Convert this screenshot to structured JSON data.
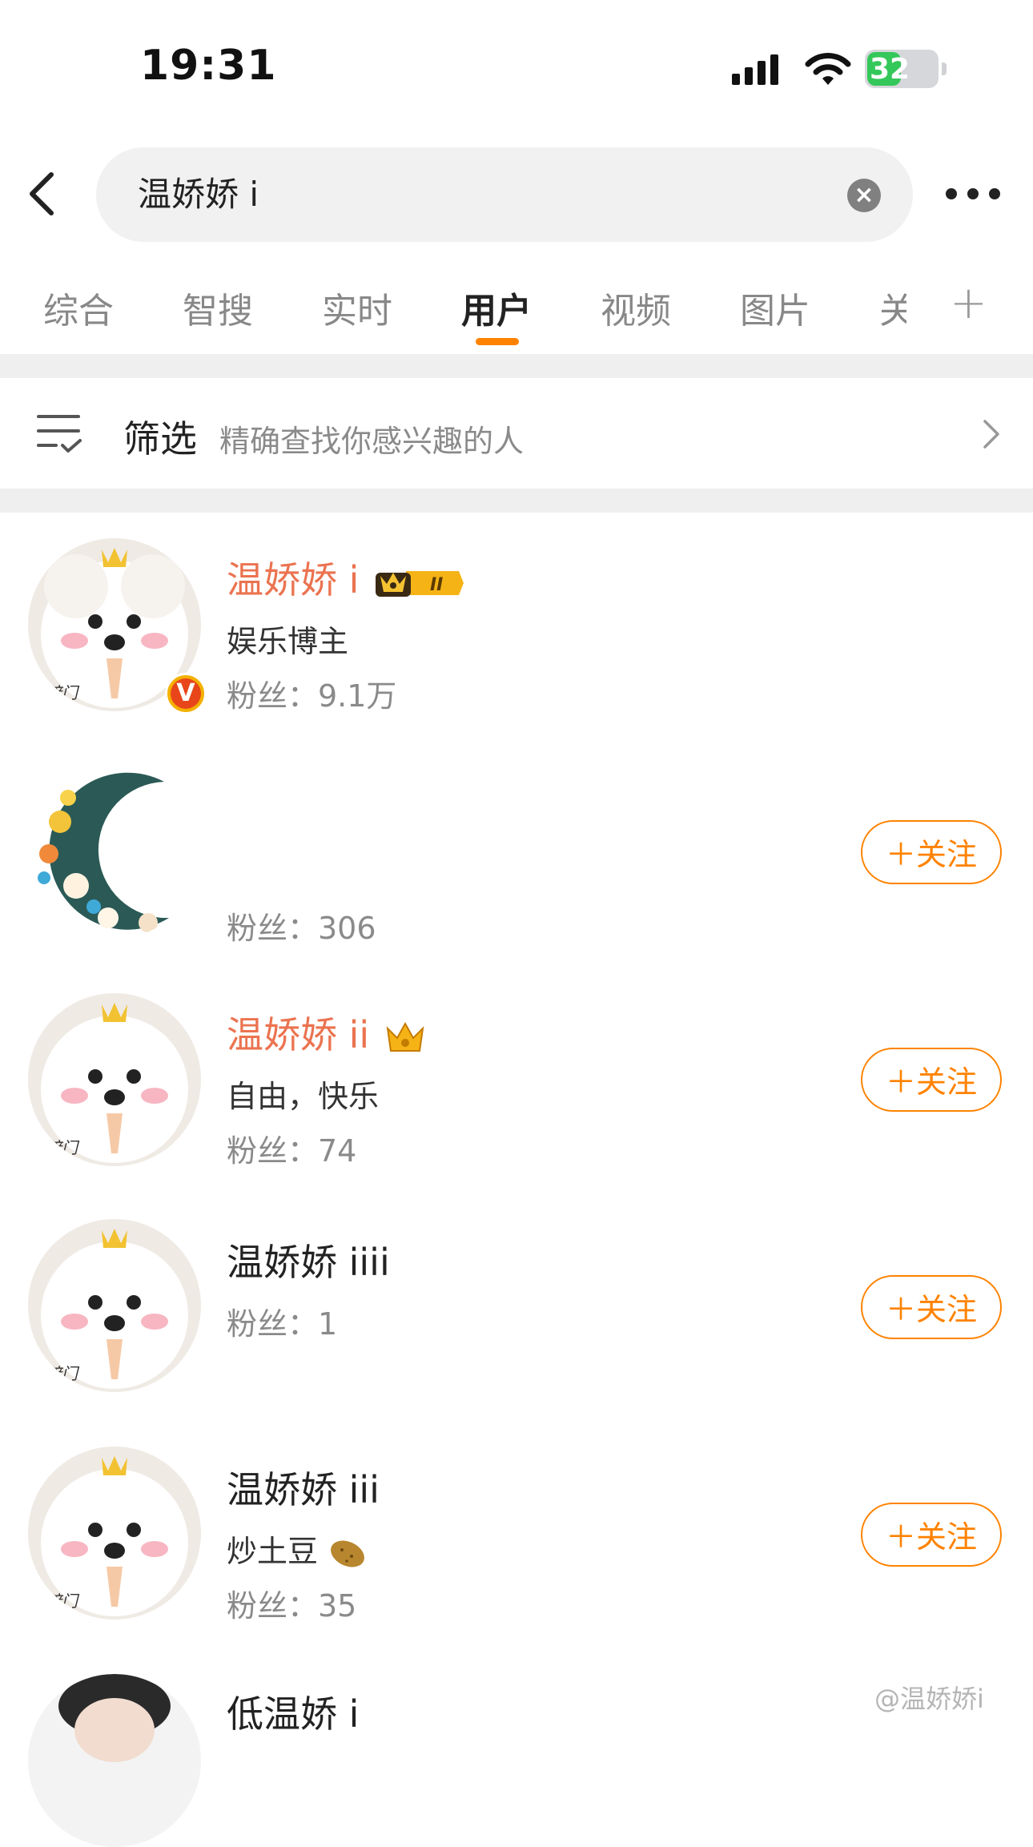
{
  "status": {
    "time": "19:31",
    "battery": "32"
  },
  "search": {
    "query": "温娇娇 i"
  },
  "tabs": [
    "综合",
    "智搜",
    "实时",
    "用户",
    "视频",
    "图片",
    "关"
  ],
  "active_tab": "用户",
  "filter": {
    "label": "筛选",
    "hint": "精确查找你感兴趣的人"
  },
  "users": [
    {
      "name": "温娇娇 i",
      "desc": "娱乐博主",
      "fans": "粉丝：9.1万",
      "verified": true
    },
    {
      "name": "",
      "desc": "",
      "fans": "粉丝：306",
      "follow": "＋关注"
    },
    {
      "name": "温娇娇 ii",
      "desc": "自由，快乐",
      "fans": "粉丝：74",
      "follow": "＋关注"
    },
    {
      "name": "温娇娇 iiii",
      "desc": "",
      "fans": "粉丝：1",
      "follow": "＋关注"
    },
    {
      "name": "温娇娇 iii",
      "desc": "炒土豆",
      "fans": "粉丝：35",
      "follow": "＋关注"
    },
    {
      "name": "低温娇 i"
    }
  ],
  "watermark": "@温娇娇i",
  "colors": {
    "accent": "#ff8200",
    "vip_name": "#eb7350"
  }
}
